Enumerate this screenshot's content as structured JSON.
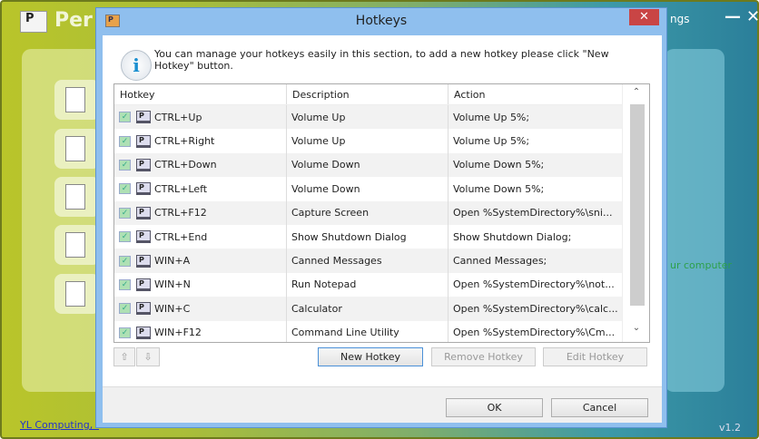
{
  "app": {
    "logo_letter": "P",
    "title": "Per",
    "settings_label": "ngs",
    "minimize": "—",
    "close": "✕",
    "status_text": "ur computer",
    "company_link": "YL Computing, I",
    "version": "v1.2"
  },
  "dialog": {
    "title": "Hotkeys",
    "close": "✕",
    "icon_letter": "P",
    "intro": "You can manage your hotkeys easily in this section, to add a new hotkey please click \"New Hotkey\" button.",
    "columns": [
      "Hotkey",
      "Description",
      "Action"
    ],
    "rows": [
      {
        "hotkey": "CTRL+Up",
        "description": "Volume Up",
        "action": "Volume Up 5%;",
        "enabled": true
      },
      {
        "hotkey": "CTRL+Right",
        "description": "Volume Up",
        "action": "Volume Up 5%;",
        "enabled": true
      },
      {
        "hotkey": "CTRL+Down",
        "description": "Volume Down",
        "action": "Volume Down 5%;",
        "enabled": true
      },
      {
        "hotkey": "CTRL+Left",
        "description": "Volume Down",
        "action": "Volume Down 5%;",
        "enabled": true
      },
      {
        "hotkey": "CTRL+F12",
        "description": "Capture Screen",
        "action": "Open %SystemDirectory%\\sni...",
        "enabled": true
      },
      {
        "hotkey": "CTRL+End",
        "description": "Show Shutdown Dialog",
        "action": "Show Shutdown Dialog;",
        "enabled": true
      },
      {
        "hotkey": "WIN+A",
        "description": "Canned Messages",
        "action": "Canned Messages;",
        "enabled": true
      },
      {
        "hotkey": "WIN+N",
        "description": "Run Notepad",
        "action": "Open %SystemDirectory%\\not...",
        "enabled": true
      },
      {
        "hotkey": "WIN+C",
        "description": "Calculator",
        "action": "Open %SystemDirectory%\\calc...",
        "enabled": true
      },
      {
        "hotkey": "WIN+F12",
        "description": "Command Line Utility",
        "action": "Open %SystemDirectory%\\Cm...",
        "enabled": true
      }
    ],
    "buttons": {
      "move_up": "⇧",
      "move_down": "⇩",
      "new": "New Hotkey",
      "remove": "Remove Hotkey",
      "edit": "Edit Hotkey",
      "ok": "OK",
      "cancel": "Cancel"
    },
    "scroll": {
      "up": "⌃",
      "down": "⌄"
    }
  }
}
